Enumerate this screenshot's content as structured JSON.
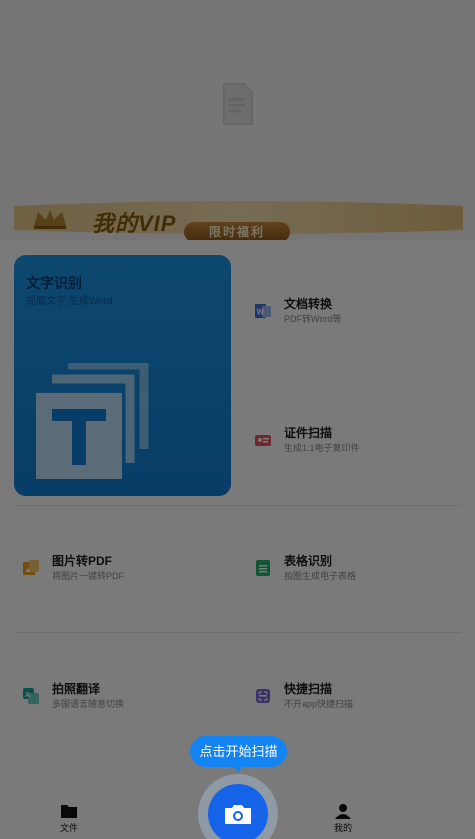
{
  "vip": {
    "title": "我的VIP",
    "button": "限时福利"
  },
  "ocr_card": {
    "title": "文字识别",
    "subtitle": "提取文字,生成Word"
  },
  "features": [
    {
      "title": "文档转换",
      "subtitle": "PDF转Word等",
      "icon": "word-doc-icon",
      "color": "#3b6fd8"
    },
    {
      "title": "证件扫描",
      "subtitle": "生成1:1电子复印件",
      "icon": "id-card-icon",
      "color": "#e05a5a"
    },
    {
      "title": "图片转PDF",
      "subtitle": "将图片一键转PDF",
      "icon": "image-pdf-icon",
      "color": "#f0a020"
    },
    {
      "title": "表格识别",
      "subtitle": "拍图生成电子表格",
      "icon": "table-icon",
      "color": "#2bb56b"
    },
    {
      "title": "拍照翻译",
      "subtitle": "多国语言随意切换",
      "icon": "translate-icon",
      "color": "#18a89a"
    },
    {
      "title": "快捷扫描",
      "subtitle": "不开app快捷扫描",
      "icon": "quick-scan-icon",
      "color": "#7a62d8"
    }
  ],
  "tooltip": "点击开始扫描",
  "tabs": {
    "files": "文件",
    "mine": "我的"
  },
  "colors": {
    "primary": "#1463e8",
    "tooltip": "#1484f5",
    "ocr_card": "#1c96e8"
  }
}
